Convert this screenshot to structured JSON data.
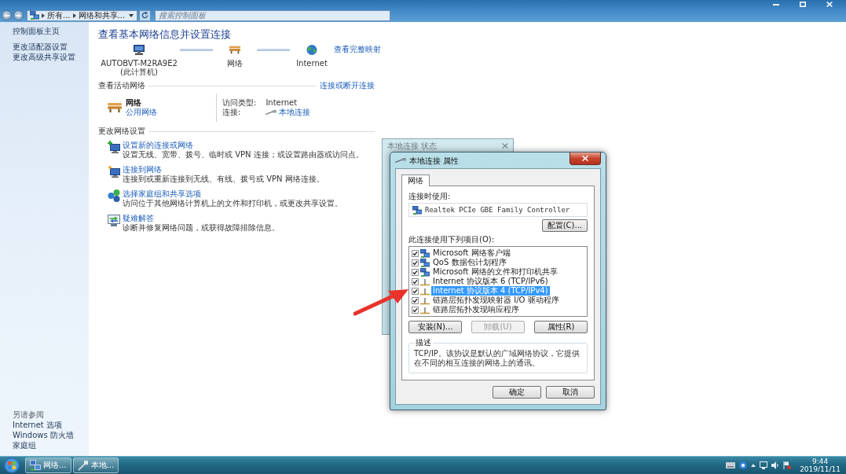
{
  "window": {
    "address_bar": {
      "breadcrumbs": [
        "所有...",
        "网络和共享..."
      ]
    },
    "search": {
      "placeholder": "搜索控制面板"
    }
  },
  "sidebar": {
    "home_link": "控制面板主页",
    "tasks": [
      "更改适配器设置",
      "更改高级共享设置"
    ],
    "see_also": {
      "title": "另请参阅",
      "links": [
        "Internet 选项",
        "Windows 防火墙",
        "家庭组"
      ]
    }
  },
  "main": {
    "title": "查看基本网络信息并设置连接",
    "full_map_link": "查看完整映射",
    "map_nodes": [
      {
        "kind": "computer",
        "label": "AUTOBVT-M2RA9E2",
        "sublabel": "(此计算机)"
      },
      {
        "kind": "network",
        "label": "网络"
      },
      {
        "kind": "internet",
        "label": "Internet"
      }
    ],
    "active_networks": {
      "title": "查看活动网络",
      "link": "连接或断开连接",
      "network": {
        "name": "网络",
        "category": "公用网络"
      },
      "details": [
        {
          "kind": "text",
          "label": "访问类型:",
          "value": "Internet"
        },
        {
          "kind": "link",
          "label": "连接:",
          "value": "本地连接"
        }
      ]
    },
    "settings": {
      "title": "更改网络设置",
      "tasks": [
        {
          "kind": "new-connection",
          "title": "设置新的连接或网络",
          "description": "设置无线、宽带、拨号、临时或 VPN 连接；或设置路由器或访问点。"
        },
        {
          "kind": "connect",
          "title": "连接到网络",
          "description": "连接到或重新连接到无线、有线、拨号或 VPN 网络连接。"
        },
        {
          "kind": "homegroup",
          "title": "选择家庭组和共享选项",
          "description": "访问位于其他网络计算机上的文件和打印机，或更改共享设置。"
        },
        {
          "kind": "troubleshoot",
          "title": "疑难解答",
          "description": "诊断并修复网络问题，或获得故障排除信息。"
        }
      ]
    }
  },
  "dialogs": {
    "status": {
      "title": "本地连接 状态"
    },
    "properties": {
      "title": "本地连接 属性",
      "tabs": [
        {
          "label": "网络",
          "selected": true
        }
      ],
      "connect_using_label": "连接时使用:",
      "adapter": "Realtek PCIe GBE Family Controller",
      "configure_button": "配置(C)...",
      "items_label": "此连接使用下列项目(O):",
      "items": [
        {
          "kind": "client",
          "label": "Microsoft 网络客户端",
          "checked": true,
          "selected": false
        },
        {
          "kind": "service",
          "label": "QoS 数据包计划程序",
          "checked": true,
          "selected": false
        },
        {
          "kind": "service",
          "label": "Microsoft 网络的文件和打印机共享",
          "checked": true,
          "selected": false
        },
        {
          "kind": "protocol",
          "label": "Internet 协议版本 6 (TCP/IPv6)",
          "checked": true,
          "selected": false
        },
        {
          "kind": "protocol",
          "label": "Internet 协议版本 4 (TCP/IPv4)",
          "checked": true,
          "selected": true
        },
        {
          "kind": "protocol",
          "label": "链路层拓扑发现映射器 I/O 驱动程序",
          "checked": true,
          "selected": false
        },
        {
          "kind": "protocol",
          "label": "链路层拓扑发现响应程序",
          "checked": true,
          "selected": false
        }
      ],
      "item_buttons": [
        {
          "label": "安装(N)...",
          "disabled": false
        },
        {
          "label": "卸载(U)",
          "disabled": true
        },
        {
          "label": "属性(R)",
          "disabled": false
        }
      ],
      "description": {
        "title": "描述",
        "text": "TCP/IP。该协议是默认的广域网络协议，它提供在不同的相互连接的网络上的通讯。"
      },
      "buttons": [
        "确定",
        "取消"
      ]
    }
  },
  "taskbar": {
    "buttons": [
      {
        "kind": "network",
        "label": "网络..."
      },
      {
        "kind": "connection",
        "label": "本地..."
      }
    ],
    "clock": {
      "time": "9:44",
      "date": "2019/11/11"
    }
  }
}
